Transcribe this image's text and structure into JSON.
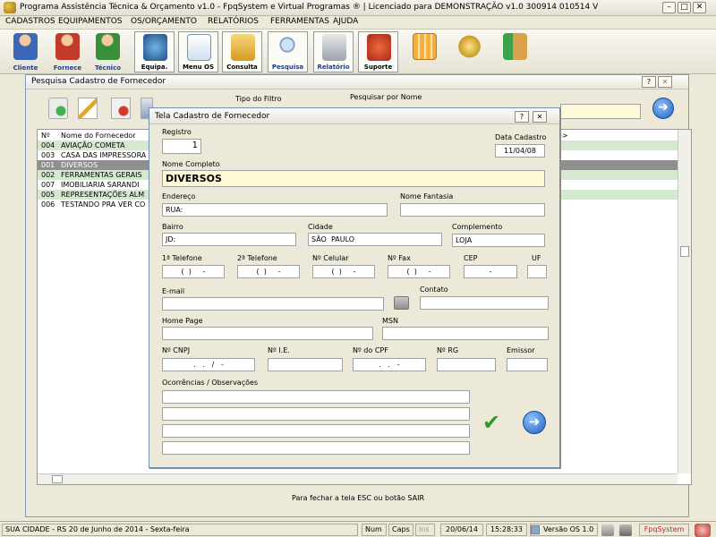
{
  "app": {
    "title": "Programa Assistência Técnica & Orçamento v1.0 - FpqSystem e Virtual Programas ® | Licenciado para  DEMONSTRAÇÃO v1.0 300914 010514 V",
    "min": "–",
    "max": "□",
    "close": "✕"
  },
  "menu": [
    "CADASTROS",
    "EQUIPAMENTOS",
    "OS/ORÇAMENTO",
    "RELATÓRIOS",
    "FERRAMENTAS",
    "AJUDA"
  ],
  "toolbar": [
    "Cliente",
    "Fornece",
    "Técnico",
    "Equipa.",
    "Menu OS",
    "Consulta",
    "Pesquisa",
    "Relatório",
    "Suporte",
    "",
    "",
    ""
  ],
  "bg_window": {
    "title": "Pesquisa Cadastro de Fornecedor",
    "help": "?",
    "close": "✕",
    "tipo_filtro_label": "Tipo do Filtro",
    "pesquisar_label": "Pesquisar por Nome",
    "grid_headers": [
      "Nº",
      "Nome do Fornecedor"
    ],
    "rows": [
      {
        "num": "004",
        "name": "AVIAÇÃO COMETA"
      },
      {
        "num": "003",
        "name": "CASA DAS IMPRESSORA"
      },
      {
        "num": "001",
        "name": "DIVERSOS"
      },
      {
        "num": "002",
        "name": "FERRAMENTAS GERAIS"
      },
      {
        "num": "007",
        "name": "IMOBILIARIA SARANDI"
      },
      {
        "num": "005",
        "name": "REPRESENTAÇÕES ALM"
      },
      {
        "num": "006",
        "name": "TESTANDO PRA VER CO"
      }
    ],
    "footer": "Para fechar a tela ESC ou botão SAIR"
  },
  "dialog": {
    "title": "Tela Cadastro de Fornecedor",
    "help": "?",
    "close": "✕",
    "registro_label": "Registro",
    "registro": "1",
    "data_cadastro_label": "Data Cadastro",
    "data_cadastro": "11/04/08",
    "nome_label": "Nome Completo",
    "nome": "DIVERSOS",
    "endereco_label": "Endereço",
    "endereco": "RUA:",
    "fantasia_label": "Nome Fantasia",
    "fantasia": "",
    "bairro_label": "Bairro",
    "bairro": "JD:",
    "cidade_label": "Cidade",
    "cidade": "SÃO  PAULO",
    "complemento_label": "Complemento",
    "complemento": "LOJA",
    "tel1_label": "1ª Telefone",
    "tel1": "(  )     -",
    "tel2_label": "2ª Telefone",
    "tel2": "(  )     -",
    "cel_label": "Nº Celular",
    "cel": "(  )     -",
    "fax_label": "Nº Fax",
    "fax": "(  )     -",
    "cep_label": "CEP",
    "cep": "-",
    "uf_label": "UF",
    "uf": "",
    "email_label": "E-mail",
    "email": "",
    "contato_label": "Contato",
    "contato": "",
    "homepage_label": "Home Page",
    "homepage": "",
    "msn_label": "MSN",
    "msn": "",
    "cnpj_label": "Nº CNPJ",
    "cnpj": ".   .   /   -",
    "ie_label": "Nº I.E.",
    "ie": "",
    "cpf_label": "Nº do CPF",
    "cpf": ".   .   -",
    "rg_label": "Nº RG",
    "rg": "",
    "emissor_label": "Emissor",
    "emissor": "",
    "obs_label": "Ocorrências / Observações"
  },
  "status": {
    "city": "SUA CIDADE - RS 20 de Junho de 2014 - Sexta-feira",
    "num": "Num",
    "caps": "Caps",
    "ins": "Ins",
    "date": "20/06/14",
    "time": "15:28:33",
    "version": "Versão OS 1.0",
    "brand": "FpqSystem"
  },
  "colors": {
    "row_highlight": "#d5e8d0",
    "row_selected": "#8f8f8f",
    "accent_blue": "#1f5fbf",
    "checkmark_green": "#2f9a25"
  }
}
